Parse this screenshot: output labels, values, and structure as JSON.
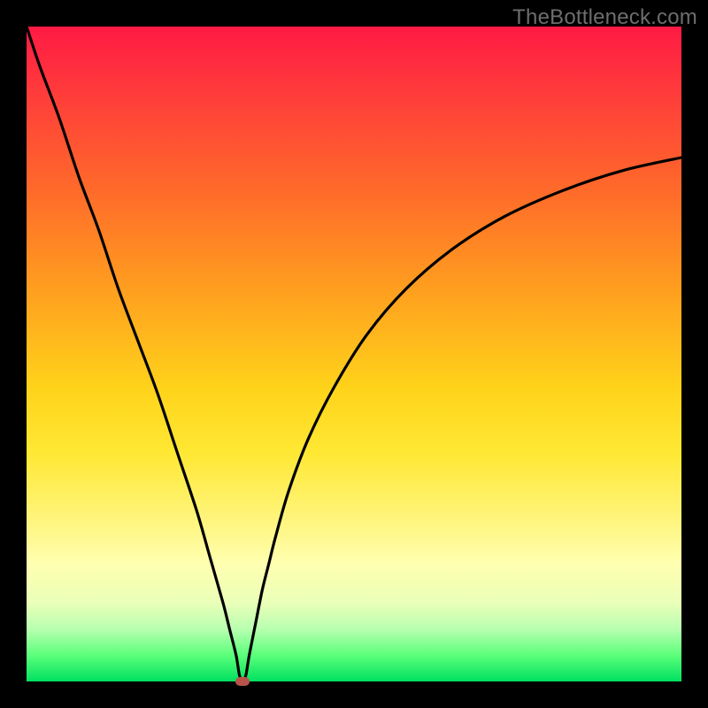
{
  "watermark": "TheBottleneck.com",
  "colors": {
    "frame": "#000000",
    "curve": "#000000",
    "marker": "#b8534a",
    "gradient_top": "#ff1a44",
    "gradient_bottom": "#00e060"
  },
  "chart_data": {
    "type": "line",
    "title": "",
    "xlabel": "",
    "ylabel": "",
    "xlim": [
      0,
      100
    ],
    "ylim": [
      0,
      100
    ],
    "x": [
      0,
      2,
      5,
      8,
      11,
      14,
      17,
      20,
      23,
      26,
      28,
      30,
      31,
      32,
      32.5,
      33,
      33.5,
      34,
      35,
      36,
      37,
      38,
      40,
      43,
      47,
      52,
      58,
      65,
      73,
      82,
      91,
      100
    ],
    "values": [
      100,
      94,
      86,
      77,
      69,
      60,
      52,
      44,
      35,
      26,
      19,
      12,
      8,
      4,
      1,
      0,
      1,
      4,
      9,
      14,
      18,
      22,
      29,
      37,
      45,
      53,
      60,
      66,
      71,
      75,
      78,
      80
    ],
    "annotations": [
      {
        "type": "marker",
        "x": 33,
        "y": 0
      }
    ]
  }
}
